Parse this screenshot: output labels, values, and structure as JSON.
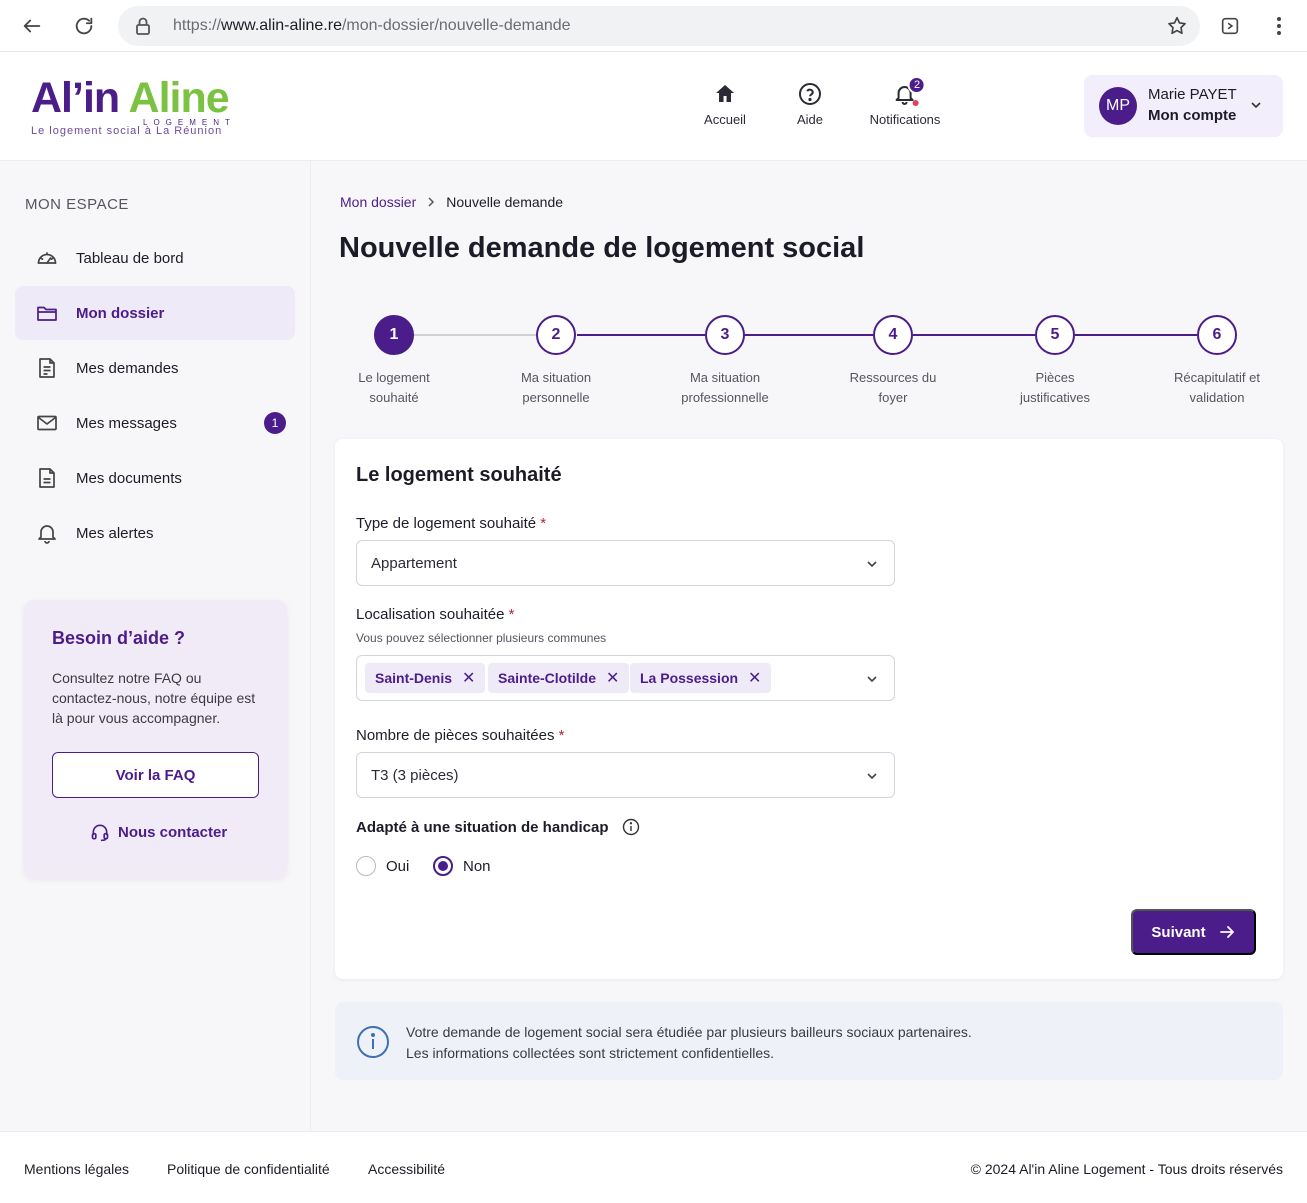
{
  "browser": {
    "url_prefix": "https://",
    "url_host": "www.alin-aline.re",
    "url_path": "/mon-dossier/nouvelle-demande"
  },
  "header": {
    "logo": {
      "main_part1": "Al’in",
      "main_part2": "Aline",
      "sub1": "LOGEMENT",
      "sub2": "Le logement social à La Réunion"
    },
    "nav": [
      {
        "label": "Accueil",
        "icon": "home-icon"
      },
      {
        "label": "Aide",
        "icon": "help-circle-icon"
      },
      {
        "label": "Notifications",
        "icon": "bell-icon",
        "badge": "2"
      }
    ],
    "account": {
      "initials": "MP",
      "name": "Marie PAYET",
      "label": "Mon compte"
    }
  },
  "sidebar": {
    "title": "MON ESPACE",
    "items": [
      {
        "label": "Tableau de bord",
        "icon": "dashboard-icon"
      },
      {
        "label": "Mon dossier",
        "icon": "folder-icon",
        "active": true
      },
      {
        "label": "Mes demandes",
        "icon": "document-icon"
      },
      {
        "label": "Mes messages",
        "icon": "mail-icon",
        "badge": "1"
      },
      {
        "label": "Mes documents",
        "icon": "file-icon"
      },
      {
        "label": "Mes alertes",
        "icon": "bell-icon"
      }
    ],
    "help": {
      "title": "Besoin d’aide ?",
      "text": "Consultez notre FAQ ou contactez-nous, notre équipe est là pour vous accompagner.",
      "faq_button": "Voir la FAQ",
      "contact_link": "Nous contacter"
    }
  },
  "main": {
    "breadcrumb": {
      "parent": "Mon dossier",
      "current": "Nouvelle demande"
    },
    "title": "Nouvelle demande de logement social",
    "steps": [
      {
        "number": "1",
        "label_line1": "Le logement",
        "label_line2": "souhaité"
      },
      {
        "number": "2",
        "label_line1": "Ma situation",
        "label_line2": "personnelle"
      },
      {
        "number": "3",
        "label_line1": "Ma situation",
        "label_line2": "professionnelle"
      },
      {
        "number": "4",
        "label_line1": "Ressources du",
        "label_line2": "foyer"
      },
      {
        "number": "5",
        "label_line1": "Pièces",
        "label_line2": "justificatives"
      },
      {
        "number": "6",
        "label_line1": "Récapitulatif et",
        "label_line2": "validation"
      }
    ],
    "current_step": 1,
    "form": {
      "title": "Le logement souhaité",
      "type_label": "Type de logement souhaité",
      "type_value": "Appartement",
      "location_label": "Localisation souhaitée",
      "location_hint": "Vous pouvez sélectionner plusieurs communes",
      "locations": [
        "Saint-Denis",
        "Sainte-Clotilde",
        "La Possession"
      ],
      "rooms_label": "Nombre de pièces souhaitées",
      "rooms_value": "T3 (3 pièces)",
      "required_mark": "*",
      "handicap_label": "Adapté à une situation de handicap",
      "handicap_options": [
        "Oui",
        "Non"
      ],
      "handicap_selected": "Non",
      "next_button": "Suivant"
    },
    "info": {
      "line1": "Votre demande de logement social sera étudiée par plusieurs bailleurs sociaux partenaires.",
      "line2": "Les informations collectées sont strictement confidentielles."
    }
  },
  "footer": {
    "links": [
      "Mentions légales",
      "Politique de confidentialité",
      "Accessibilité"
    ],
    "copyright": "© 2024 Al'in Aline Logement - Tous droits réservés"
  },
  "colors": {
    "primary": "#4b1d8a",
    "brand_green": "#7cc242",
    "required": "#c0213a"
  }
}
